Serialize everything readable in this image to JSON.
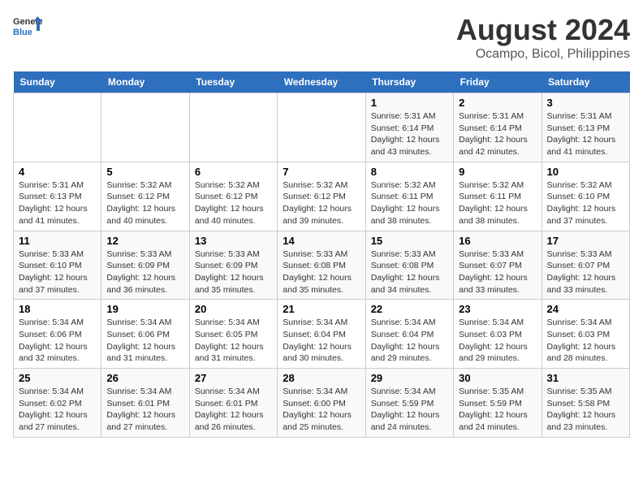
{
  "header": {
    "logo_line1": "General",
    "logo_line2": "Blue",
    "title": "August 2024",
    "subtitle": "Ocampo, Bicol, Philippines"
  },
  "weekdays": [
    "Sunday",
    "Monday",
    "Tuesday",
    "Wednesday",
    "Thursday",
    "Friday",
    "Saturday"
  ],
  "weeks": [
    [
      {
        "day": "",
        "sunrise": "",
        "sunset": "",
        "daylight": ""
      },
      {
        "day": "",
        "sunrise": "",
        "sunset": "",
        "daylight": ""
      },
      {
        "day": "",
        "sunrise": "",
        "sunset": "",
        "daylight": ""
      },
      {
        "day": "",
        "sunrise": "",
        "sunset": "",
        "daylight": ""
      },
      {
        "day": "1",
        "sunrise": "Sunrise: 5:31 AM",
        "sunset": "Sunset: 6:14 PM",
        "daylight": "Daylight: 12 hours and 43 minutes."
      },
      {
        "day": "2",
        "sunrise": "Sunrise: 5:31 AM",
        "sunset": "Sunset: 6:14 PM",
        "daylight": "Daylight: 12 hours and 42 minutes."
      },
      {
        "day": "3",
        "sunrise": "Sunrise: 5:31 AM",
        "sunset": "Sunset: 6:13 PM",
        "daylight": "Daylight: 12 hours and 41 minutes."
      }
    ],
    [
      {
        "day": "4",
        "sunrise": "Sunrise: 5:31 AM",
        "sunset": "Sunset: 6:13 PM",
        "daylight": "Daylight: 12 hours and 41 minutes."
      },
      {
        "day": "5",
        "sunrise": "Sunrise: 5:32 AM",
        "sunset": "Sunset: 6:12 PM",
        "daylight": "Daylight: 12 hours and 40 minutes."
      },
      {
        "day": "6",
        "sunrise": "Sunrise: 5:32 AM",
        "sunset": "Sunset: 6:12 PM",
        "daylight": "Daylight: 12 hours and 40 minutes."
      },
      {
        "day": "7",
        "sunrise": "Sunrise: 5:32 AM",
        "sunset": "Sunset: 6:12 PM",
        "daylight": "Daylight: 12 hours and 39 minutes."
      },
      {
        "day": "8",
        "sunrise": "Sunrise: 5:32 AM",
        "sunset": "Sunset: 6:11 PM",
        "daylight": "Daylight: 12 hours and 38 minutes."
      },
      {
        "day": "9",
        "sunrise": "Sunrise: 5:32 AM",
        "sunset": "Sunset: 6:11 PM",
        "daylight": "Daylight: 12 hours and 38 minutes."
      },
      {
        "day": "10",
        "sunrise": "Sunrise: 5:32 AM",
        "sunset": "Sunset: 6:10 PM",
        "daylight": "Daylight: 12 hours and 37 minutes."
      }
    ],
    [
      {
        "day": "11",
        "sunrise": "Sunrise: 5:33 AM",
        "sunset": "Sunset: 6:10 PM",
        "daylight": "Daylight: 12 hours and 37 minutes."
      },
      {
        "day": "12",
        "sunrise": "Sunrise: 5:33 AM",
        "sunset": "Sunset: 6:09 PM",
        "daylight": "Daylight: 12 hours and 36 minutes."
      },
      {
        "day": "13",
        "sunrise": "Sunrise: 5:33 AM",
        "sunset": "Sunset: 6:09 PM",
        "daylight": "Daylight: 12 hours and 35 minutes."
      },
      {
        "day": "14",
        "sunrise": "Sunrise: 5:33 AM",
        "sunset": "Sunset: 6:08 PM",
        "daylight": "Daylight: 12 hours and 35 minutes."
      },
      {
        "day": "15",
        "sunrise": "Sunrise: 5:33 AM",
        "sunset": "Sunset: 6:08 PM",
        "daylight": "Daylight: 12 hours and 34 minutes."
      },
      {
        "day": "16",
        "sunrise": "Sunrise: 5:33 AM",
        "sunset": "Sunset: 6:07 PM",
        "daylight": "Daylight: 12 hours and 33 minutes."
      },
      {
        "day": "17",
        "sunrise": "Sunrise: 5:33 AM",
        "sunset": "Sunset: 6:07 PM",
        "daylight": "Daylight: 12 hours and 33 minutes."
      }
    ],
    [
      {
        "day": "18",
        "sunrise": "Sunrise: 5:34 AM",
        "sunset": "Sunset: 6:06 PM",
        "daylight": "Daylight: 12 hours and 32 minutes."
      },
      {
        "day": "19",
        "sunrise": "Sunrise: 5:34 AM",
        "sunset": "Sunset: 6:06 PM",
        "daylight": "Daylight: 12 hours and 31 minutes."
      },
      {
        "day": "20",
        "sunrise": "Sunrise: 5:34 AM",
        "sunset": "Sunset: 6:05 PM",
        "daylight": "Daylight: 12 hours and 31 minutes."
      },
      {
        "day": "21",
        "sunrise": "Sunrise: 5:34 AM",
        "sunset": "Sunset: 6:04 PM",
        "daylight": "Daylight: 12 hours and 30 minutes."
      },
      {
        "day": "22",
        "sunrise": "Sunrise: 5:34 AM",
        "sunset": "Sunset: 6:04 PM",
        "daylight": "Daylight: 12 hours and 29 minutes."
      },
      {
        "day": "23",
        "sunrise": "Sunrise: 5:34 AM",
        "sunset": "Sunset: 6:03 PM",
        "daylight": "Daylight: 12 hours and 29 minutes."
      },
      {
        "day": "24",
        "sunrise": "Sunrise: 5:34 AM",
        "sunset": "Sunset: 6:03 PM",
        "daylight": "Daylight: 12 hours and 28 minutes."
      }
    ],
    [
      {
        "day": "25",
        "sunrise": "Sunrise: 5:34 AM",
        "sunset": "Sunset: 6:02 PM",
        "daylight": "Daylight: 12 hours and 27 minutes."
      },
      {
        "day": "26",
        "sunrise": "Sunrise: 5:34 AM",
        "sunset": "Sunset: 6:01 PM",
        "daylight": "Daylight: 12 hours and 27 minutes."
      },
      {
        "day": "27",
        "sunrise": "Sunrise: 5:34 AM",
        "sunset": "Sunset: 6:01 PM",
        "daylight": "Daylight: 12 hours and 26 minutes."
      },
      {
        "day": "28",
        "sunrise": "Sunrise: 5:34 AM",
        "sunset": "Sunset: 6:00 PM",
        "daylight": "Daylight: 12 hours and 25 minutes."
      },
      {
        "day": "29",
        "sunrise": "Sunrise: 5:34 AM",
        "sunset": "Sunset: 5:59 PM",
        "daylight": "Daylight: 12 hours and 24 minutes."
      },
      {
        "day": "30",
        "sunrise": "Sunrise: 5:35 AM",
        "sunset": "Sunset: 5:59 PM",
        "daylight": "Daylight: 12 hours and 24 minutes."
      },
      {
        "day": "31",
        "sunrise": "Sunrise: 5:35 AM",
        "sunset": "Sunset: 5:58 PM",
        "daylight": "Daylight: 12 hours and 23 minutes."
      }
    ]
  ]
}
